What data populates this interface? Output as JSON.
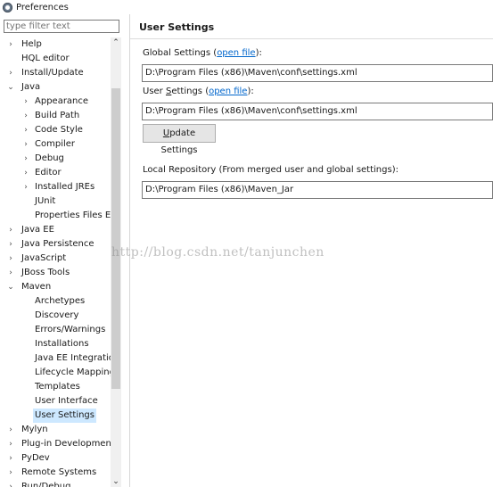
{
  "window": {
    "title": "Preferences"
  },
  "filter": {
    "placeholder": "type filter text"
  },
  "tree": [
    {
      "label": "Help",
      "level": 0,
      "arrow": "›"
    },
    {
      "label": "HQL editor",
      "level": 0,
      "arrow": ""
    },
    {
      "label": "Install/Update",
      "level": 0,
      "arrow": "›"
    },
    {
      "label": "Java",
      "level": 0,
      "arrow": "⌄"
    },
    {
      "label": "Appearance",
      "level": 1,
      "arrow": "›"
    },
    {
      "label": "Build Path",
      "level": 1,
      "arrow": "›"
    },
    {
      "label": "Code Style",
      "level": 1,
      "arrow": "›"
    },
    {
      "label": "Compiler",
      "level": 1,
      "arrow": "›"
    },
    {
      "label": "Debug",
      "level": 1,
      "arrow": "›"
    },
    {
      "label": "Editor",
      "level": 1,
      "arrow": "›"
    },
    {
      "label": "Installed JREs",
      "level": 1,
      "arrow": "›"
    },
    {
      "label": "JUnit",
      "level": 1,
      "arrow": ""
    },
    {
      "label": "Properties Files Ed",
      "level": 1,
      "arrow": ""
    },
    {
      "label": "Java EE",
      "level": 0,
      "arrow": "›"
    },
    {
      "label": "Java Persistence",
      "level": 0,
      "arrow": "›"
    },
    {
      "label": "JavaScript",
      "level": 0,
      "arrow": "›"
    },
    {
      "label": "JBoss Tools",
      "level": 0,
      "arrow": "›"
    },
    {
      "label": "Maven",
      "level": 0,
      "arrow": "⌄"
    },
    {
      "label": "Archetypes",
      "level": 1,
      "arrow": ""
    },
    {
      "label": "Discovery",
      "level": 1,
      "arrow": ""
    },
    {
      "label": "Errors/Warnings",
      "level": 1,
      "arrow": ""
    },
    {
      "label": "Installations",
      "level": 1,
      "arrow": ""
    },
    {
      "label": "Java EE Integratio",
      "level": 1,
      "arrow": ""
    },
    {
      "label": "Lifecycle Mapping",
      "level": 1,
      "arrow": ""
    },
    {
      "label": "Templates",
      "level": 1,
      "arrow": ""
    },
    {
      "label": "User Interface",
      "level": 1,
      "arrow": ""
    },
    {
      "label": "User Settings",
      "level": 1,
      "arrow": "",
      "selected": true
    },
    {
      "label": "Mylyn",
      "level": 0,
      "arrow": "›"
    },
    {
      "label": "Plug-in Development",
      "level": 0,
      "arrow": "›"
    },
    {
      "label": "PyDev",
      "level": 0,
      "arrow": "›"
    },
    {
      "label": "Remote Systems",
      "level": 0,
      "arrow": "›"
    },
    {
      "label": "Run/Debug",
      "level": 0,
      "arrow": "›"
    }
  ],
  "page": {
    "title": "User Settings",
    "global_label": "Global Settings (",
    "global_link": "open file",
    "global_suffix": "):",
    "global_path": "D:\\Program Files (x86)\\Maven\\conf\\settings.xml",
    "user_label_prefix": "User ",
    "user_label_u": "S",
    "user_label_rest": "ettings (",
    "user_link": "open file",
    "user_suffix": "):",
    "user_path": "D:\\Program Files (x86)\\Maven\\conf\\settings.xml",
    "update_prefix": "",
    "update_u": "U",
    "update_rest": "pdate Settings",
    "local_repo_label": "Local Repository (From merged user and global settings):",
    "local_repo_path": "D:\\Program Files (x86)\\Maven_Jar"
  },
  "watermark": "http://blog.csdn.net/tanjunchen"
}
